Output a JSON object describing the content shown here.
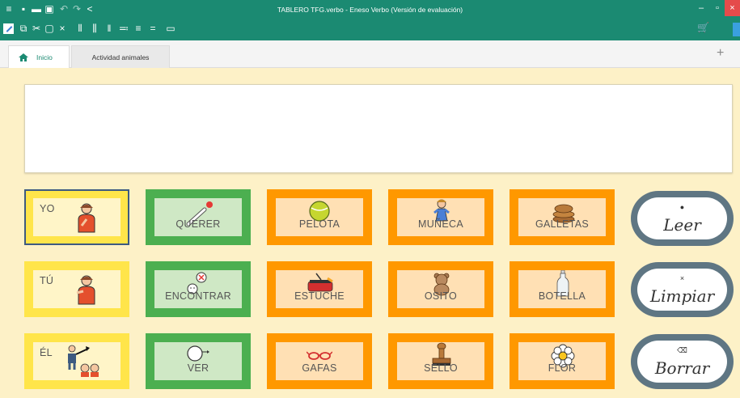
{
  "window": {
    "title": "TABLERO TFG.verbo - Eneso Verbo (Versión de evaluación)",
    "toolbar_icons": [
      "menu-icon",
      "new-file-icon",
      "open-folder-icon",
      "save-icon",
      "undo-icon",
      "redo-icon",
      "share-icon"
    ],
    "edit_icons": [
      "edit-mode-icon",
      "copy-icon",
      "cut-icon",
      "paste-icon",
      "delete-icon",
      "columns-add-icon",
      "columns-insert-icon",
      "columns-remove-icon",
      "rows-add-icon",
      "rows-insert-icon",
      "rows-remove-icon",
      "comment-icon"
    ],
    "cart_icon": "cart-icon"
  },
  "tabs": [
    {
      "label": "Inicio",
      "icon": "home-icon",
      "active": true
    },
    {
      "label": "Actividad animales",
      "active": false
    }
  ],
  "add_tab_label": "+",
  "message": {
    "text": ""
  },
  "grid": [
    [
      {
        "label": "YO",
        "color": "yellow",
        "picto": "person-pointing-self",
        "selected": true
      },
      {
        "label": "QUERER",
        "color": "green",
        "picto": "hand-reaching"
      },
      {
        "label": "PELOTA",
        "color": "orange",
        "picto": "ball"
      },
      {
        "label": "MUÑECA",
        "color": "orange",
        "picto": "doll"
      },
      {
        "label": "GALLETAS",
        "color": "orange",
        "picto": "cookies"
      }
    ],
    [
      {
        "label": "TÚ",
        "color": "yellow",
        "picto": "person-pointing-you"
      },
      {
        "label": "ENCONTRAR",
        "color": "green",
        "picto": "find-face"
      },
      {
        "label": "ESTUCHE",
        "color": "orange",
        "picto": "pencil-case"
      },
      {
        "label": "OSITO",
        "color": "orange",
        "picto": "teddy-bear"
      },
      {
        "label": "BOTELLA",
        "color": "orange",
        "picto": "bottle"
      }
    ],
    [
      {
        "label": "ÉL",
        "color": "yellow",
        "picto": "person-pointing-him"
      },
      {
        "label": "VER",
        "color": "green",
        "picto": "eye-looking"
      },
      {
        "label": "GAFAS",
        "color": "orange",
        "picto": "glasses"
      },
      {
        "label": "SELLO",
        "color": "orange",
        "picto": "stamp"
      },
      {
        "label": "FLOR",
        "color": "orange",
        "picto": "flower"
      }
    ]
  ],
  "actions": [
    {
      "label": "Leer",
      "icon_glyph": "●"
    },
    {
      "label": "Limpiar",
      "icon_glyph": "×"
    },
    {
      "label": "Borrar",
      "icon_glyph": "⌫"
    }
  ],
  "colors": {
    "titlebar": "#1b8a72",
    "background": "#fdf1c7",
    "yellow": "#ffe54a",
    "green": "#4caf50",
    "orange": "#ff9800",
    "action": "#5f7683",
    "close": "#e54b4b"
  }
}
